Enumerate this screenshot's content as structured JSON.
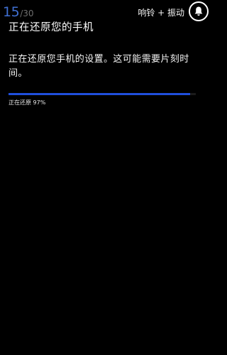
{
  "status_bar": {
    "counter_current": "15",
    "counter_total": "/30",
    "ring_mode": "响铃 + 振动",
    "bell_icon": "bell-icon"
  },
  "page": {
    "title": "正在还原您的手机",
    "description": "正在还原您手机的设置。这可能需要片刻时间。"
  },
  "progress": {
    "label": "正在还原 97%",
    "value": 0.97
  },
  "colors": {
    "background": "#000000",
    "accent": "#1f4fdc",
    "counter": "#3f6fd2",
    "text": "#ffffff"
  }
}
